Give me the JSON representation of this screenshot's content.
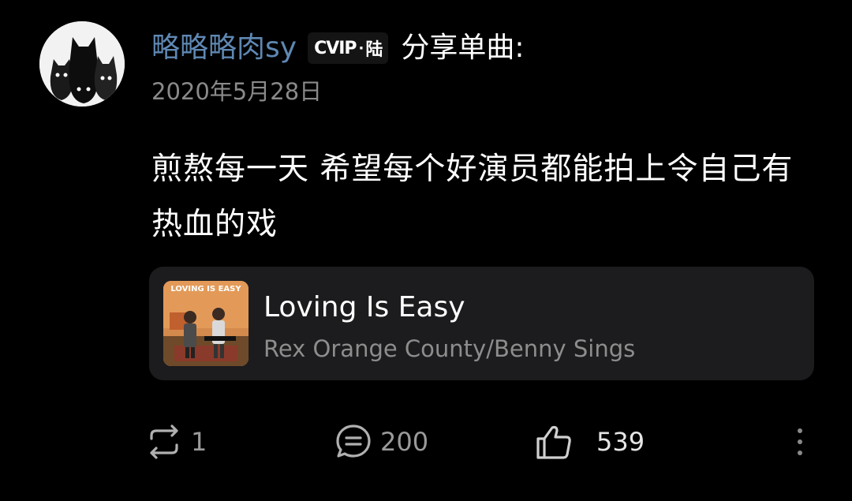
{
  "post": {
    "username": "略略略肉sy",
    "vip_badge": {
      "text_left": "CVIP",
      "dot": "·",
      "text_right": "陆"
    },
    "share_label": "分享单曲:",
    "date": "2020年5月28日",
    "content": "煎熬每一天 希望每个好演员都能拍上令自己有热血的戏"
  },
  "song": {
    "title": "Loving Is Easy",
    "artist": "Rex Orange County/Benny Sings",
    "cover_text": "LOVING IS EASY"
  },
  "actions": {
    "repost_count": "1",
    "comment_count": "200",
    "like_count": "539"
  },
  "icons": {
    "repost": "repost-icon",
    "comment": "comment-icon",
    "like": "thumbs-up-icon",
    "more": "more-vertical-icon"
  },
  "colors": {
    "background": "#000000",
    "username": "#5f88b3",
    "card": "#1c1c1e",
    "muted": "#8a8a8a"
  }
}
